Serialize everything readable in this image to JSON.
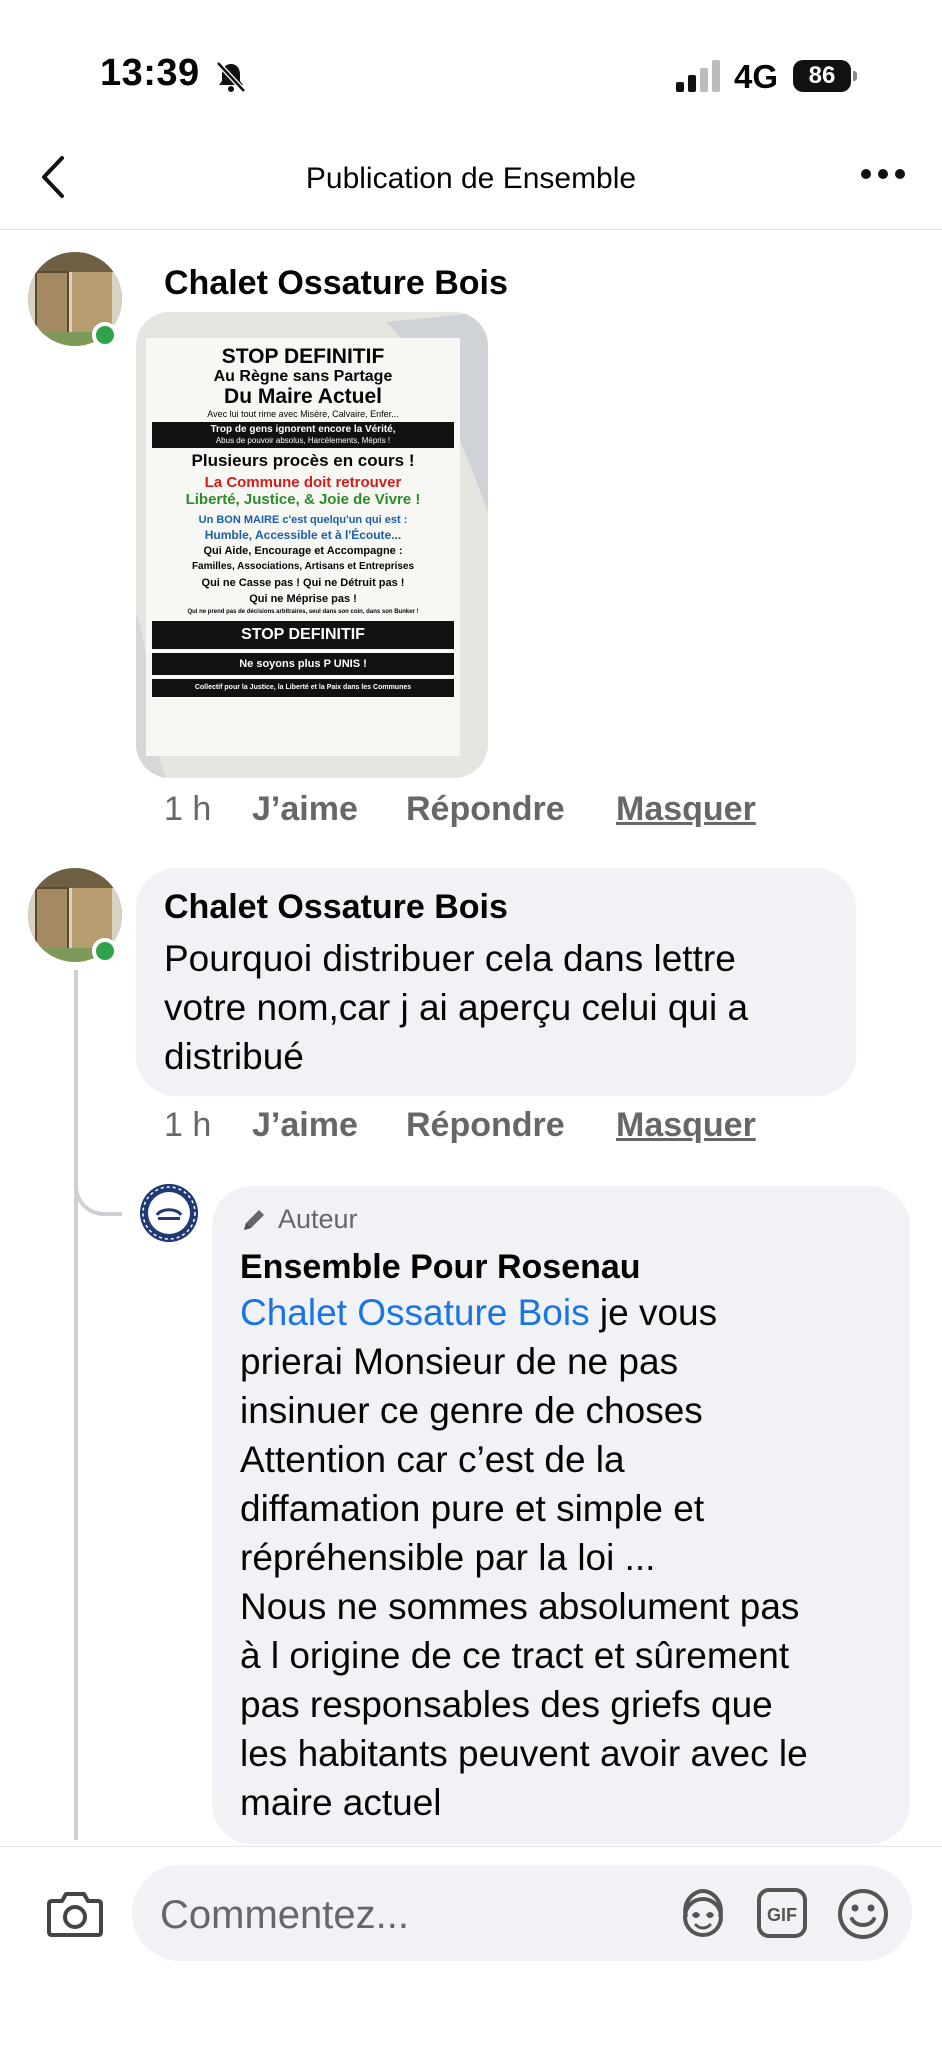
{
  "status_bar": {
    "time": "13:39",
    "network": "4G",
    "battery": "86"
  },
  "header": {
    "title": "Publication de Ensemble"
  },
  "comments": [
    {
      "author": "Chalet Ossature Bois",
      "time": "1 h",
      "like_label": "J’aime",
      "reply_label": "Répondre",
      "hide_label": "Masquer",
      "image": {
        "lines": [
          "STOP DEFINITIF",
          "Au Règne sans Partage",
          "Du Maire Actuel",
          "Avec lui tout rime avec Misère, Calvaire, Enfer...",
          "Trop de gens ignorent encore la Vérité,",
          "Abus de pouvoir absolus, Harcèlements, Mépris !",
          "Plusieurs procès en cours !",
          "La Commune doit retrouver",
          "Liberté, Justice, & Joie de Vivre !",
          "Un BON MAIRE c'est quelqu'un qui est :",
          "Humble, Accessible et à l'Écoute...",
          "Qui Aide, Encourage et Accompagne :",
          "Familles, Associations, Artisans et Entreprises",
          "Qui ne Casse pas ! Qui ne Détruit pas !",
          "Qui ne Méprise pas !",
          "Qui ne prend pas de décisions arbitraires, seul dans son coin, dans son Bunker !",
          "STOP DEFINITIF",
          "Ne soyons plus P UNIS !",
          "Collectif pour la Justice, la Liberté et la Paix dans les Communes"
        ]
      }
    },
    {
      "author": "Chalet Ossature Bois",
      "text_lines": [
        "Pourquoi distribuer cela dans lettre",
        "votre nom,car j ai aperçu celui qui a",
        "distribué"
      ],
      "time": "1 h",
      "like_label": "J’aime",
      "reply_label": "Répondre",
      "hide_label": "Masquer"
    }
  ],
  "reply": {
    "badge": "Auteur",
    "author": "Ensemble Pour Rosenau",
    "mention": "Chalet Ossature Bois",
    "first_line_rest": " je vous",
    "text_lines": [
      "prierai Monsieur de ne pas",
      "insinuer ce genre de choses",
      "Attention car c’est de la",
      "diffamation pure et simple et",
      "répréhensible par la loi ...",
      "Nous ne sommes absolument pas",
      "à l origine de ce tract et sûrement",
      "pas responsables des griefs que",
      "les habitants peuvent avoir avec le",
      "maire actuel"
    ]
  },
  "composer": {
    "placeholder": "Commentez..."
  }
}
